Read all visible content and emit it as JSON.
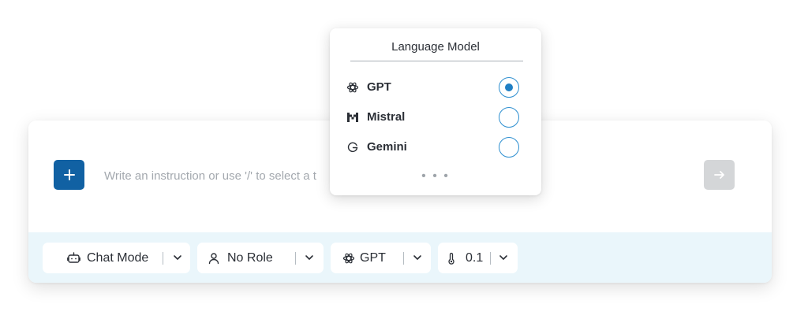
{
  "composer": {
    "input_placeholder": "Write an instruction or use '/' to select a t",
    "add_icon": "plus-icon",
    "send_icon": "arrow-right-icon"
  },
  "toolbar": {
    "mode_label": "Chat Mode",
    "mode_icon": "robot-icon",
    "role_label": "No Role",
    "role_icon": "user-icon",
    "model_label": "GPT",
    "model_icon": "openai-icon",
    "temperature_label": "0.1",
    "temperature_icon": "thermometer-icon"
  },
  "model_popup": {
    "title": "Language Model",
    "options": [
      {
        "label": "GPT",
        "icon": "openai-icon",
        "selected": true
      },
      {
        "label": "Mistral",
        "icon": "mistral-icon",
        "selected": false
      },
      {
        "label": "Gemini",
        "icon": "google-icon",
        "selected": false
      }
    ],
    "more_label": "• • •"
  },
  "colors": {
    "accent": "#1161a3",
    "radio": "#2e8fd0",
    "toolbar_bg": "#eaf6fb",
    "send_disabled": "#d4d6d8"
  }
}
